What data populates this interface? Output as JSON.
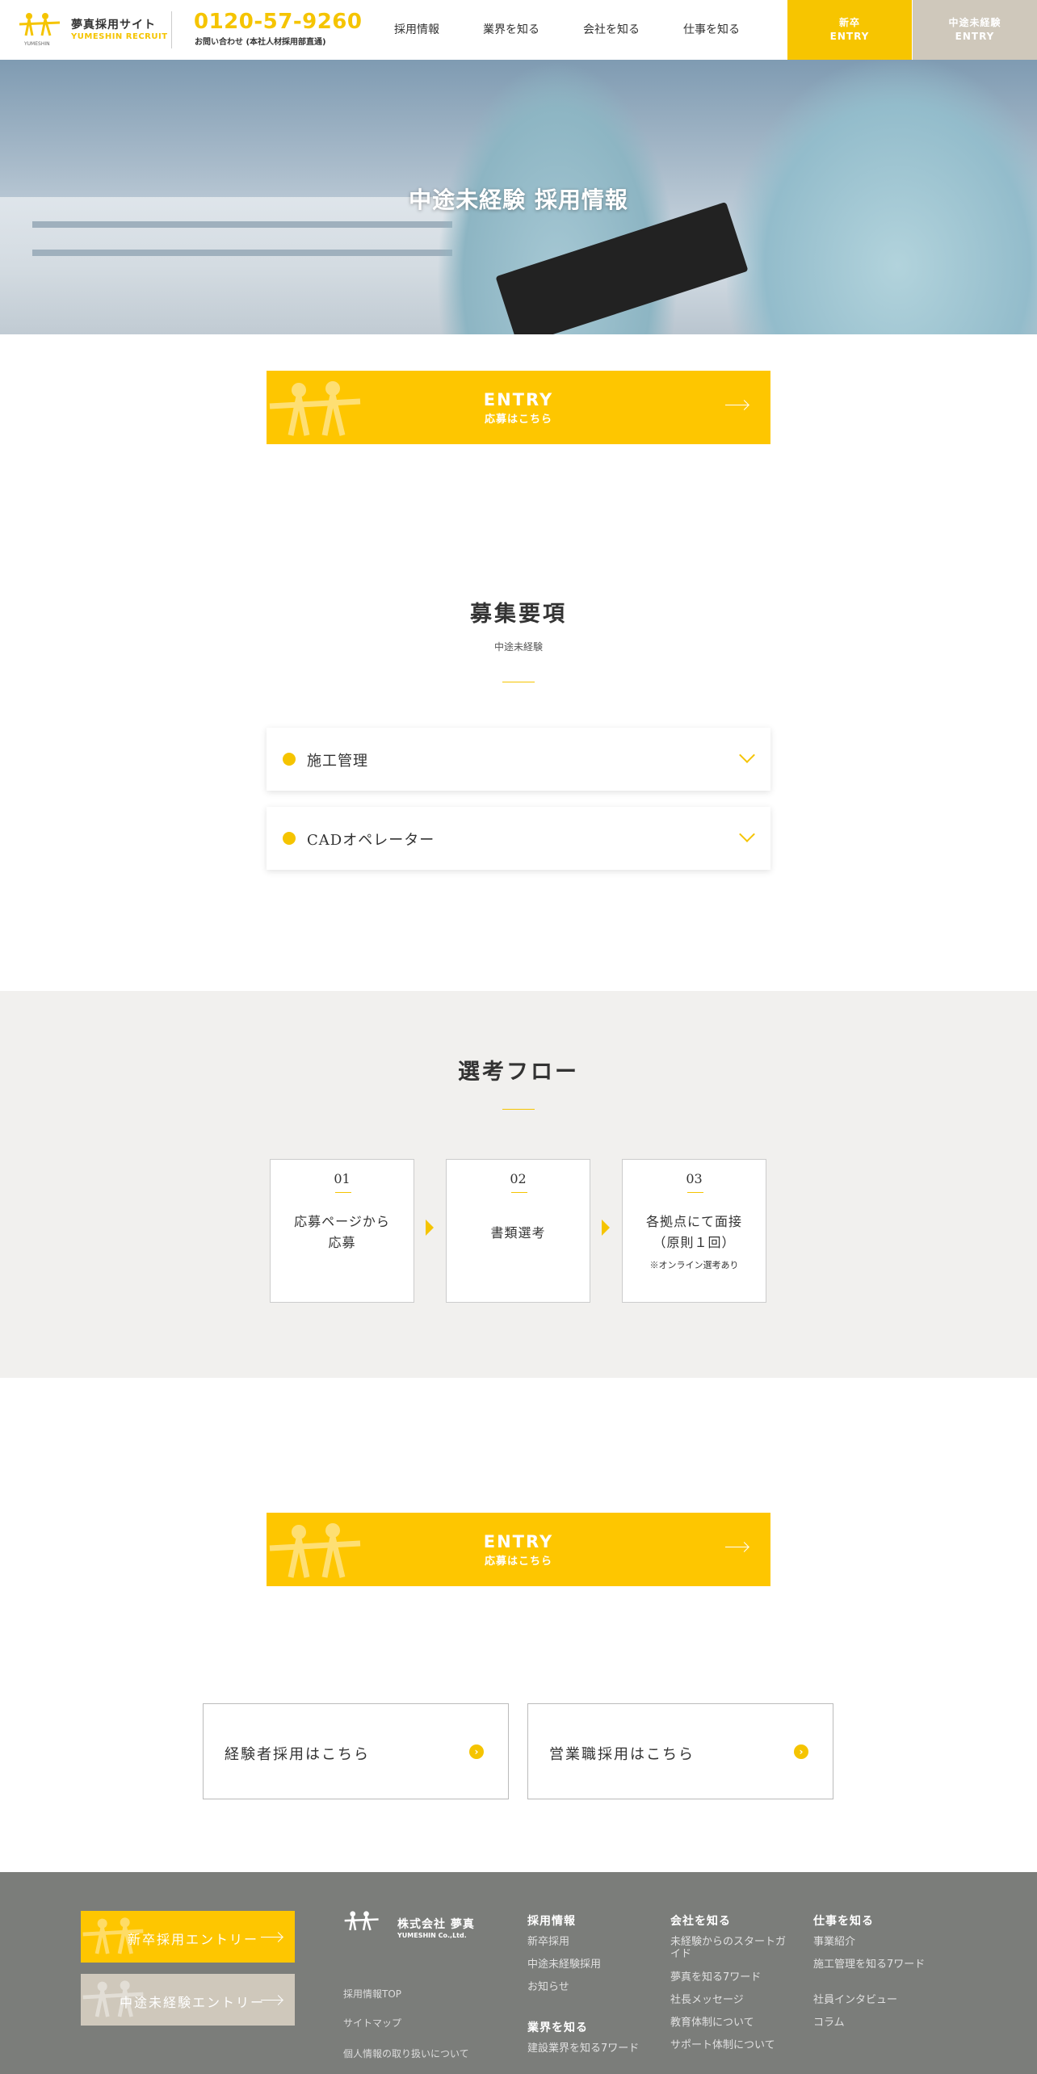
{
  "header": {
    "site_name": "夢真採用サイト",
    "site_sub": "YUMESHIN RECRUIT",
    "tel": "0120-57-9260",
    "tel_note": "お問い合わせ (本社人材採用部直通)",
    "nav": [
      "採用情報",
      "業界を知る",
      "会社を知る",
      "仕事を知る"
    ],
    "entry_new": {
      "line1": "新卒",
      "line2": "ENTRY"
    },
    "entry_mid": {
      "line1": "中途未経験",
      "line2": "ENTRY"
    }
  },
  "hero": {
    "title": "中途未経験 採用情報"
  },
  "entry_banner": {
    "en": "ENTRY",
    "jp": "応募はこちら"
  },
  "requirements": {
    "title": "募集要項",
    "subtitle": "中途未経験",
    "items": [
      "施工管理",
      "CADオペレーター"
    ]
  },
  "flow": {
    "title": "選考フロー",
    "steps": [
      {
        "num": "01",
        "text1": "応募ページから",
        "text2": "応募",
        "note": ""
      },
      {
        "num": "02",
        "text1": "書類選考",
        "text2": "",
        "note": ""
      },
      {
        "num": "03",
        "text1": "各拠点にて面接",
        "text2": "（原則１回）",
        "note": "※オンライン選考あり"
      }
    ]
  },
  "links": [
    {
      "label": "経験者採用はこちら"
    },
    {
      "label": "営業職採用はこちら"
    }
  ],
  "footer": {
    "entry_new": "新卒採用エントリー",
    "entry_mid": "中途未経験エントリー",
    "company": "株式会社 夢真",
    "company_en": "YUMESHIN Co.,Ltd.",
    "small_links": [
      "採用情報TOP",
      "サイトマップ",
      "個人情報の取り扱いについて"
    ],
    "col1": {
      "head": "採用情報",
      "links": [
        "新卒採用",
        "中途未経験採用",
        "お知らせ"
      ],
      "head2": "業界を知る",
      "links2": [
        "建設業界を知る7ワード"
      ]
    },
    "col2": {
      "head": "会社を知る",
      "links": [
        "未経験からのスタートガイド",
        "夢真を知る7ワード",
        "社長メッセージ",
        "教育体制について",
        "サポート体制について"
      ]
    },
    "col3": {
      "head": "仕事を知る",
      "links": [
        "事業紹介",
        "施工管理を知る7ワード",
        "社員インタビュー",
        "コラム"
      ]
    }
  },
  "colors": {
    "accent": "#f5c400",
    "banner": "#fec600",
    "beige": "#cfc8bb",
    "footer": "#7b7d7a",
    "section_bg": "#f1f0ee"
  }
}
